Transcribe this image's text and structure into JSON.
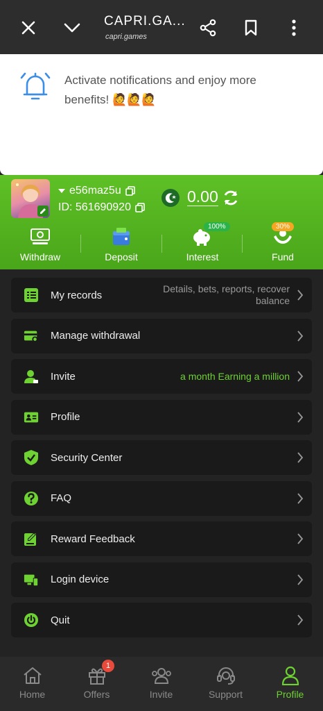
{
  "topbar": {
    "title": "CAPRI.GA...",
    "subtitle": "capri.games"
  },
  "notification": {
    "message": "Activate notifications and enjoy more benefits! 🙋🙋🙋"
  },
  "user": {
    "username": "e56maz5u",
    "id_label": "ID: 561690920",
    "balance": "0.00"
  },
  "quick_actions": [
    {
      "label": "Withdraw"
    },
    {
      "label": "Deposit"
    },
    {
      "label": "Interest",
      "badge": "100%"
    },
    {
      "label": "Fund",
      "badge": "30%"
    }
  ],
  "menu": [
    {
      "label": "My records",
      "note": "Details, bets, reports, recover balance"
    },
    {
      "label": "Manage withdrawal"
    },
    {
      "label": "Invite",
      "note": "a month  Earning a million"
    },
    {
      "label": "Profile"
    },
    {
      "label": "Security Center"
    },
    {
      "label": "FAQ"
    },
    {
      "label": "Reward Feedback"
    },
    {
      "label": "Login device"
    },
    {
      "label": "Quit"
    }
  ],
  "bottom_nav": [
    {
      "label": "Home"
    },
    {
      "label": "Offers",
      "badge": "1"
    },
    {
      "label": "Invite"
    },
    {
      "label": "Support"
    },
    {
      "label": "Profile"
    }
  ],
  "colors": {
    "accent": "#6ed232",
    "header_green": "#52b020",
    "background": "#232323"
  }
}
